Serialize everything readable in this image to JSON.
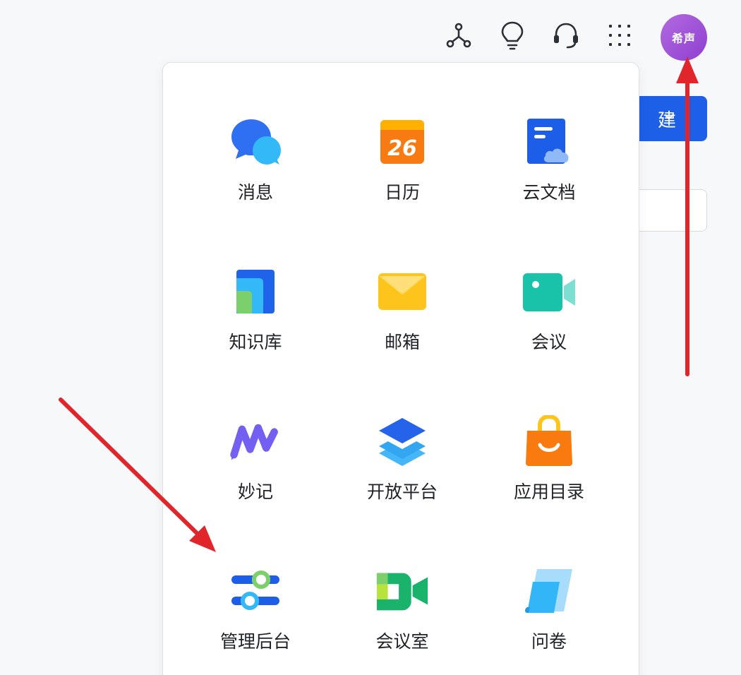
{
  "topbar": {
    "icons": [
      "graph-nodes-icon",
      "lightbulb-icon",
      "headset-icon",
      "app-grid-icon"
    ],
    "avatar_text": "希声"
  },
  "background": {
    "new_button_label": "建"
  },
  "apps": [
    {
      "label": "消息",
      "icon": "message-bubbles-icon"
    },
    {
      "label": "日历",
      "icon": "calendar-icon",
      "day": "26"
    },
    {
      "label": "云文档",
      "icon": "cloud-doc-icon"
    },
    {
      "label": "知识库",
      "icon": "knowledge-base-icon"
    },
    {
      "label": "邮箱",
      "icon": "mail-envelope-icon"
    },
    {
      "label": "会议",
      "icon": "video-meeting-icon"
    },
    {
      "label": "妙记",
      "icon": "minutes-pen-icon"
    },
    {
      "label": "开放平台",
      "icon": "layers-icon"
    },
    {
      "label": "应用目录",
      "icon": "shopping-bag-icon"
    },
    {
      "label": "管理后台",
      "icon": "sliders-icon"
    },
    {
      "label": "会议室",
      "icon": "meeting-room-icon"
    },
    {
      "label": "问卷",
      "icon": "survey-icon"
    }
  ],
  "colors": {
    "primary_blue": "#1e5fe8",
    "annotation_red": "#e0252b",
    "avatar_purple": "#9b4fd8"
  }
}
